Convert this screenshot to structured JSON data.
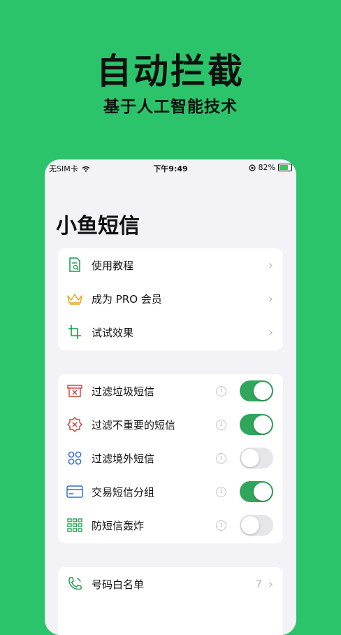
{
  "hero": {
    "title": "自动拦截",
    "subtitle": "基于人工智能技术"
  },
  "status_bar": {
    "carrier": "无SIM卡",
    "time": "下午9:49",
    "battery": "82%",
    "battery_level": 0.82
  },
  "app": {
    "title": "小鱼短信"
  },
  "menu": {
    "items": [
      {
        "label": "使用教程",
        "icon": "document-search-icon"
      },
      {
        "label": "成为 PRO 会员",
        "icon": "crown-icon"
      },
      {
        "label": "试试效果",
        "icon": "crop-icon"
      }
    ]
  },
  "filters": {
    "items": [
      {
        "label": "过滤垃圾短信",
        "icon": "trash-box-icon",
        "enabled": true
      },
      {
        "label": "过滤不重要的短信",
        "icon": "badge-x-icon",
        "enabled": true
      },
      {
        "label": "过滤境外短信",
        "icon": "loops-icon",
        "enabled": false
      },
      {
        "label": "交易短信分组",
        "icon": "credit-card-icon",
        "enabled": true
      },
      {
        "label": "防短信轰炸",
        "icon": "grid-icon",
        "enabled": false
      }
    ]
  },
  "whitelist": {
    "label": "号码白名单",
    "count": "7",
    "icon": "phone-icon"
  },
  "colors": {
    "background": "#2bc46a",
    "toggle_on": "#30a65a",
    "icon_green": "#1a9a4a",
    "icon_red": "#d23a3a",
    "icon_blue": "#2f6fd6",
    "icon_gold": "#e8a628"
  }
}
